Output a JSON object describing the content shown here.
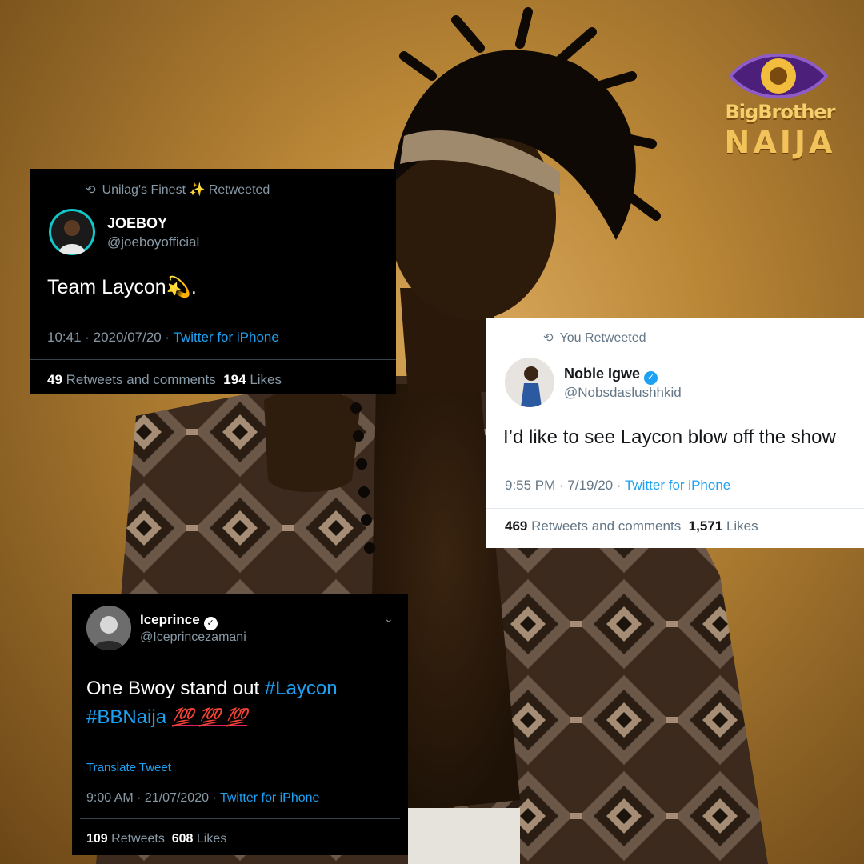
{
  "brand": {
    "line1": "BigBrother",
    "line2": "NAIJA"
  },
  "tweets": {
    "joeboy": {
      "retweet_line": "Unilag's Finest ✨ Retweeted",
      "name": "JOEBOY",
      "handle": "@joeboyofficial",
      "text": "Team Laycon",
      "text_emoji": "💫.",
      "time": "10:41 · 2020/07/20 ·",
      "source": "Twitter for iPhone",
      "retweets": "49",
      "retweets_label": "Retweets and comments",
      "likes": "194",
      "likes_label": "Likes",
      "icons": {
        "retweet": "retweet-icon",
        "avatar": "avatar"
      }
    },
    "noble": {
      "retweet_line": "You Retweeted",
      "name": "Noble Igwe",
      "handle": "@Nobsdaslushhkid",
      "text": "I’d like to see Laycon blow off the show",
      "time": "9:55 PM · 7/19/20 ·",
      "source": "Twitter for iPhone",
      "retweets": "469",
      "retweets_label": "Retweets and comments",
      "likes": "1,571",
      "likes_label": "Likes",
      "icons": {
        "retweet": "retweet-icon",
        "verified": "verified-badge-icon"
      }
    },
    "iceprince": {
      "name": "Iceprince",
      "handle": "@Iceprincezamani",
      "text_line1": "One Bwoy stand out",
      "hashtag1": "#Laycon",
      "hashtag2": "#BBNaija",
      "emoji": "💯 💯 💯",
      "translate": "Translate Tweet",
      "time": "9:00 AM · 21/07/2020 ·",
      "source": "Twitter for iPhone",
      "retweets": "109",
      "retweets_label": "Retweets",
      "likes": "608",
      "likes_label": "Likes",
      "icons": {
        "verified": "verified-badge-icon",
        "chevron": "chevron-down-icon"
      }
    }
  },
  "colors": {
    "twitter_blue": "#1da1f2",
    "dark_card": "#000000",
    "light_card": "#ffffff",
    "gold": "#f1c35a"
  }
}
